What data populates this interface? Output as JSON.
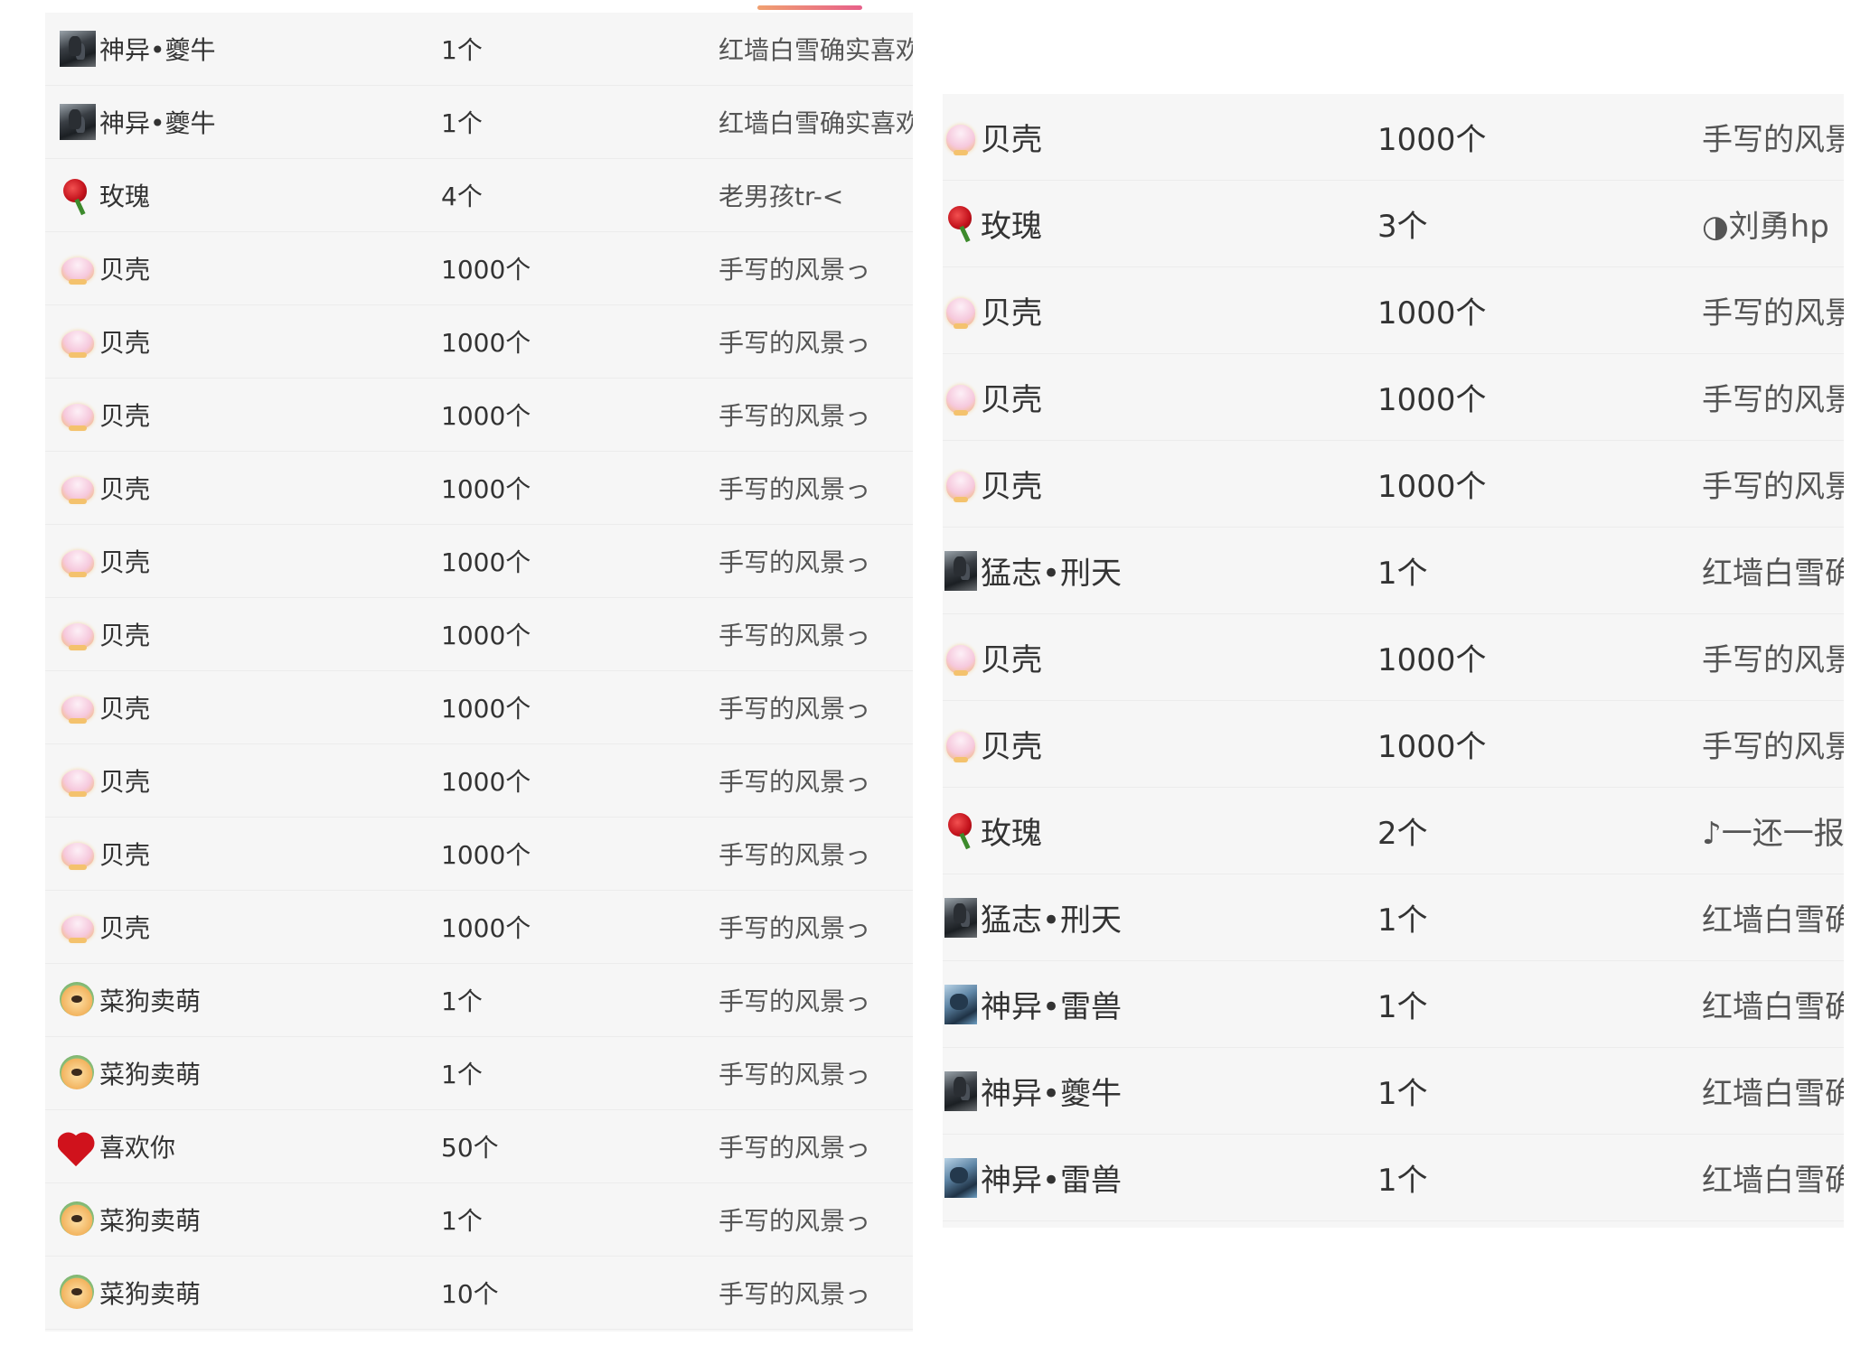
{
  "left_list": {
    "rows": [
      {
        "gift": "神异•夔牛",
        "icon": "warrior-icon",
        "qty": "1个",
        "sender": "红墙白雪确实喜欢"
      },
      {
        "gift": "神异•夔牛",
        "icon": "warrior-icon",
        "qty": "1个",
        "sender": "红墙白雪确实喜欢"
      },
      {
        "gift": "玫瑰",
        "icon": "rose-icon",
        "qty": "4个",
        "sender": "老男孩tr-<"
      },
      {
        "gift": "贝壳",
        "icon": "shell-icon",
        "qty": "1000个",
        "sender": "手写的风景っ"
      },
      {
        "gift": "贝壳",
        "icon": "shell-icon",
        "qty": "1000个",
        "sender": "手写的风景っ"
      },
      {
        "gift": "贝壳",
        "icon": "shell-icon",
        "qty": "1000个",
        "sender": "手写的风景っ"
      },
      {
        "gift": "贝壳",
        "icon": "shell-icon",
        "qty": "1000个",
        "sender": "手写的风景っ"
      },
      {
        "gift": "贝壳",
        "icon": "shell-icon",
        "qty": "1000个",
        "sender": "手写的风景っ"
      },
      {
        "gift": "贝壳",
        "icon": "shell-icon",
        "qty": "1000个",
        "sender": "手写的风景っ"
      },
      {
        "gift": "贝壳",
        "icon": "shell-icon",
        "qty": "1000个",
        "sender": "手写的风景っ"
      },
      {
        "gift": "贝壳",
        "icon": "shell-icon",
        "qty": "1000个",
        "sender": "手写的风景っ"
      },
      {
        "gift": "贝壳",
        "icon": "shell-icon",
        "qty": "1000个",
        "sender": "手写的风景っ"
      },
      {
        "gift": "贝壳",
        "icon": "shell-icon",
        "qty": "1000个",
        "sender": "手写的风景っ"
      },
      {
        "gift": "菜狗卖萌",
        "icon": "dog-icon",
        "qty": "1个",
        "sender": "手写的风景っ"
      },
      {
        "gift": "菜狗卖萌",
        "icon": "dog-icon",
        "qty": "1个",
        "sender": "手写的风景っ"
      },
      {
        "gift": "喜欢你",
        "icon": "heart-icon",
        "qty": "50个",
        "sender": "手写的风景っ"
      },
      {
        "gift": "菜狗卖萌",
        "icon": "dog-icon",
        "qty": "1个",
        "sender": "手写的风景っ"
      },
      {
        "gift": "菜狗卖萌",
        "icon": "dog-icon",
        "qty": "10个",
        "sender": "手写的风景っ"
      }
    ]
  },
  "right_list": {
    "rows": [
      {
        "gift": "贝壳",
        "icon": "shell-icon",
        "qty": "1000个",
        "sender": "手写的风景"
      },
      {
        "gift": "玫瑰",
        "icon": "rose-icon",
        "qty": "3个",
        "sender": "◑刘勇hp"
      },
      {
        "gift": "贝壳",
        "icon": "shell-icon",
        "qty": "1000个",
        "sender": "手写的风景"
      },
      {
        "gift": "贝壳",
        "icon": "shell-icon",
        "qty": "1000个",
        "sender": "手写的风景"
      },
      {
        "gift": "贝壳",
        "icon": "shell-icon",
        "qty": "1000个",
        "sender": "手写的风景"
      },
      {
        "gift": "猛志•刑天",
        "icon": "warrior-icon",
        "qty": "1个",
        "sender": "红墙白雪确"
      },
      {
        "gift": "贝壳",
        "icon": "shell-icon",
        "qty": "1000个",
        "sender": "手写的风景"
      },
      {
        "gift": "贝壳",
        "icon": "shell-icon",
        "qty": "1000个",
        "sender": "手写的风景"
      },
      {
        "gift": "玫瑰",
        "icon": "rose-icon",
        "qty": "2个",
        "sender": "♪一还一报"
      },
      {
        "gift": "猛志•刑天",
        "icon": "warrior-icon",
        "qty": "1个",
        "sender": "红墙白雪确"
      },
      {
        "gift": "神异•雷兽",
        "icon": "beast-icon",
        "qty": "1个",
        "sender": "红墙白雪确"
      },
      {
        "gift": "神异•夔牛",
        "icon": "warrior-icon",
        "qty": "1个",
        "sender": "红墙白雪确"
      },
      {
        "gift": "神异•雷兽",
        "icon": "beast-icon",
        "qty": "1个",
        "sender": "红墙白雪确"
      }
    ]
  }
}
